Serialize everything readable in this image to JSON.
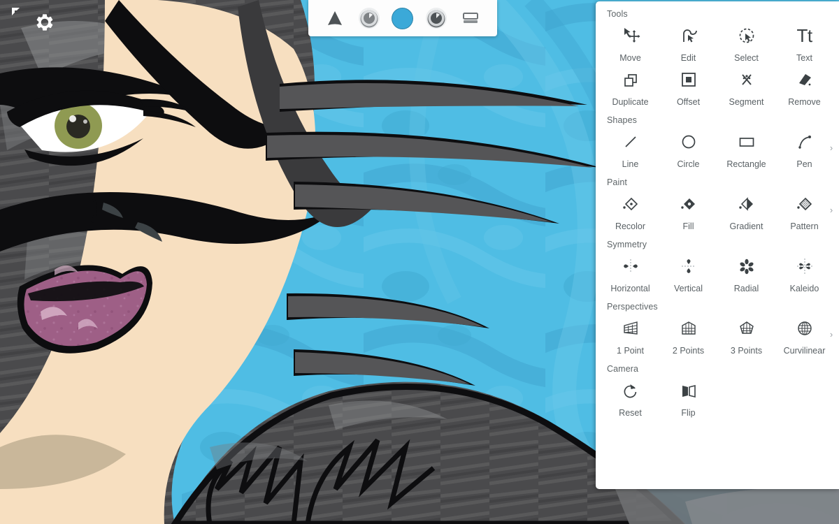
{
  "app": {
    "canvas_background_color": "#4fbde4",
    "artwork_description": "anime-style vector portrait with gray spiky hair, green eye and mauve lips on cyan swirl background",
    "artwork_colors": {
      "skin": "#f7dfc0",
      "skin_shadow": "#c9b79a",
      "hair_dark": "#4a4a4c",
      "hair_mid": "#6e6f71",
      "hair_light": "#8e9092",
      "outline": "#0d0d0f",
      "eye_iris": "#8f9a52",
      "eye_white": "#ffffff",
      "lips": "#9e5f86",
      "lips_highlight": "#c79ab4",
      "background_blue": "#4fbde4",
      "background_blue_dark": "#3fa6cf"
    }
  },
  "gear_button": {
    "icon": "gear-icon",
    "color": "#ffffff"
  },
  "corner_marker": {
    "icon": "corner-bracket-icon",
    "color": "#ffffff"
  },
  "toolbar": {
    "items": [
      {
        "label": "Brush",
        "icon": "brush-tip-triangle-icon"
      },
      {
        "label": "Brush Size",
        "icon": "dial-knob-icon"
      },
      {
        "label": "Color",
        "icon": "color-swatch-circle-icon",
        "color": "#3ba9d8"
      },
      {
        "label": "Opacity",
        "icon": "dial-knob-dark-icon"
      },
      {
        "label": "Layers",
        "icon": "layers-panel-icon"
      }
    ]
  },
  "tools_panel": {
    "sections": [
      {
        "title": "Tools",
        "has_chevron": false,
        "items": [
          {
            "label": "Move",
            "icon": "move-cursor-icon"
          },
          {
            "label": "Edit",
            "icon": "edit-node-icon"
          },
          {
            "label": "Select",
            "icon": "lasso-select-icon"
          },
          {
            "label": "Text",
            "icon": "text-tt-icon"
          }
        ]
      },
      {
        "title": "",
        "has_chevron": false,
        "items": [
          {
            "label": "Duplicate",
            "icon": "duplicate-squares-icon"
          },
          {
            "label": "Offset",
            "icon": "offset-square-icon"
          },
          {
            "label": "Segment",
            "icon": "segment-scissors-icon"
          },
          {
            "label": "Remove",
            "icon": "eraser-icon"
          }
        ]
      },
      {
        "title": "Shapes",
        "has_chevron": true,
        "items": [
          {
            "label": "Line",
            "icon": "line-icon"
          },
          {
            "label": "Circle",
            "icon": "circle-icon"
          },
          {
            "label": "Rectangle",
            "icon": "rectangle-icon"
          },
          {
            "label": "Pen",
            "icon": "pen-curve-icon"
          }
        ]
      },
      {
        "title": "Paint",
        "has_chevron": true,
        "items": [
          {
            "label": "Recolor",
            "icon": "diamond-outline-icon"
          },
          {
            "label": "Fill",
            "icon": "diamond-filled-icon"
          },
          {
            "label": "Gradient",
            "icon": "diamond-half-filled-icon"
          },
          {
            "label": "Pattern",
            "icon": "diamond-hatched-icon"
          }
        ]
      },
      {
        "title": "Symmetry",
        "has_chevron": false,
        "items": [
          {
            "label": "Horizontal",
            "icon": "symmetry-horizontal-icon"
          },
          {
            "label": "Vertical",
            "icon": "symmetry-vertical-icon"
          },
          {
            "label": "Radial",
            "icon": "symmetry-radial-icon"
          },
          {
            "label": "Kaleido",
            "icon": "symmetry-kaleido-icon"
          }
        ]
      },
      {
        "title": "Perspectives",
        "has_chevron": true,
        "items": [
          {
            "label": "1 Point",
            "icon": "perspective-1-point-icon"
          },
          {
            "label": "2 Points",
            "icon": "perspective-2-points-icon"
          },
          {
            "label": "3 Points",
            "icon": "perspective-3-points-icon"
          },
          {
            "label": "Curvilinear",
            "icon": "perspective-curvilinear-icon"
          }
        ]
      },
      {
        "title": "Camera",
        "has_chevron": false,
        "items": [
          {
            "label": "Reset",
            "icon": "reset-rotate-icon"
          },
          {
            "label": "Flip",
            "icon": "flip-book-icon"
          }
        ]
      }
    ],
    "chevron_glyph": "›"
  }
}
